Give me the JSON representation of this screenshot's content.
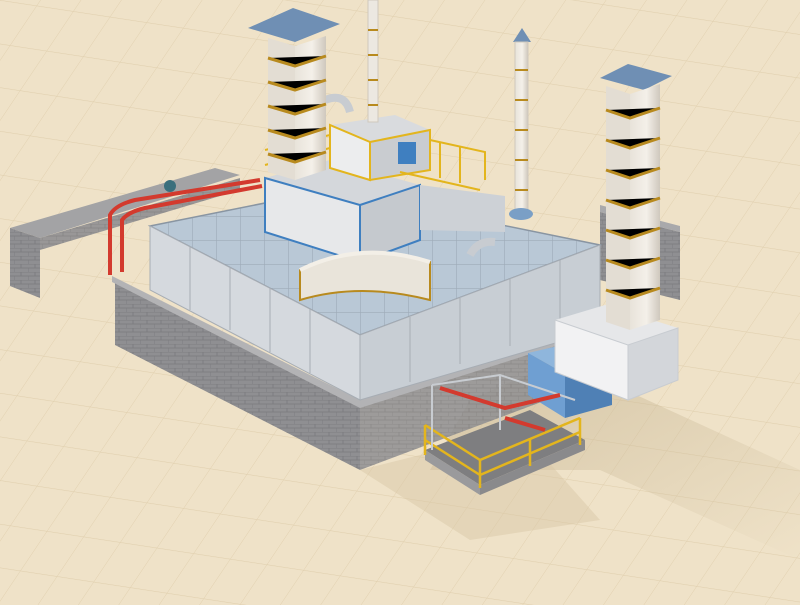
{
  "scene": {
    "subject": "industrial-facility-3d-model",
    "colors": {
      "ground": "#efe2c8",
      "grid_line": "#e2d2b2",
      "brick": "#8c8c8f",
      "brick_top": "#a9a9ab",
      "chimney_body": "#efeae2",
      "chimney_band": "#b88a1e",
      "chimney_cap": "#6f8fb4",
      "glass_roof": "#b3c4d3",
      "frame": "#c8ccd1",
      "accent_blue": "#3f7fc0",
      "railing_yellow": "#e3b51d",
      "pipe_red": "#d33a2e",
      "cabinet_blue": "#6f9fd2"
    }
  }
}
